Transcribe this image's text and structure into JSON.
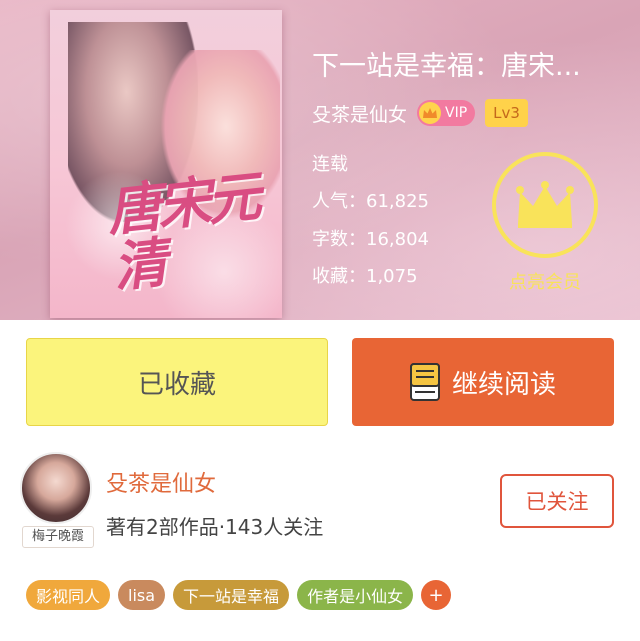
{
  "book": {
    "title": "下一站是幸福：唐宋...",
    "author": "殳茶是仙女",
    "vip_label": "VIP",
    "level": "Lv3",
    "status": "连载",
    "popularity": "人气：61,825",
    "words": "字数：16,804",
    "favorites": "收藏：1,075",
    "cover_title": "唐宋元清"
  },
  "vip": {
    "label": "点亮会员",
    "color": "#f9e35a"
  },
  "actions": {
    "favorite_label": "已收藏",
    "read_label": "继续阅读",
    "favorite_color": "#fbf47c",
    "read_color": "#e86535"
  },
  "author": {
    "name": "殳茶是仙女",
    "info": "著有2部作品·143人关注",
    "avatar_tag": "梅子晚霞",
    "follow_label": "已关注"
  },
  "tags": [
    {
      "label": "影视同人",
      "color": "#f0a83c"
    },
    {
      "label": "lisa",
      "color": "#c98a5e"
    },
    {
      "label": "下一站是幸福",
      "color": "#c79a3a"
    },
    {
      "label": "作者是小仙女",
      "color": "#8bb54a"
    }
  ],
  "more_tags_label": "+"
}
